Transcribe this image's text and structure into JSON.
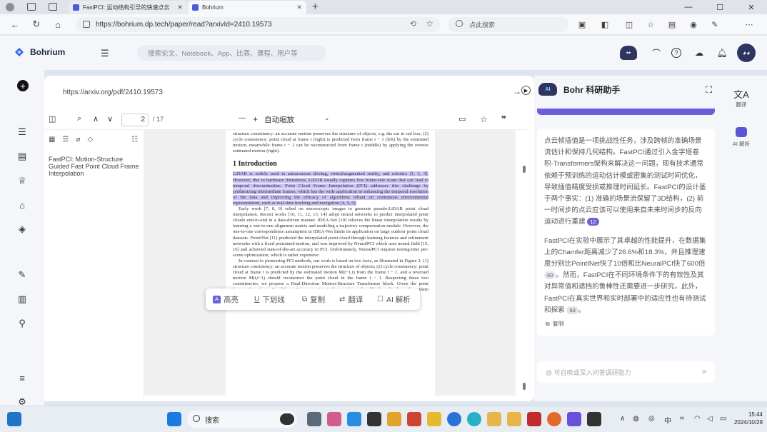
{
  "browser": {
    "tabs": [
      {
        "title": "FastPCI: 运动结构引导的快速点云"
      },
      {
        "title": "Bohrium"
      }
    ],
    "new_tab": "+",
    "url": "https://bohrium.dp.tech/paper/read?arxivId=2410.19573",
    "search_placeholder": "点此搜索"
  },
  "app": {
    "brand": "Bohrium",
    "search_placeholder": "搜索论文、Notebook、App、比赛、课程、用户等"
  },
  "pdf": {
    "source_url": "https://arxiv.org/pdf/2410.19573",
    "page_current": "2",
    "page_total": "/ 17",
    "zoom": "自动缩放",
    "zoom_minus": "—",
    "zoom_plus": "+",
    "outline_title": "FastPCI: Motion-Structure Guided Fast Point Cloud Frame Interpolation",
    "page_text": {
      "top_para": "structure consistency: an accurate motion preserves the structure of objects, e.g. the car in red box; (2) cycle consistency: point cloud at frame t (right) is predicted from frame t − 1 (left) by the estimated motion, meanwhile frame t − 1 can be reconstructed from frame t (middle) by applying the reverse estimated motion (right).",
      "section_title": "1   Introduction",
      "highlight_para": "LiDAR is widely used in autonomous driving, virtual/augmented reality, and robotics [1, 2, 3]. However, due to hardware limitations, LiDAR usually captures low frame-rate scans that can lead to temporal discontinuities. Point Cloud Frame Interpolation (PCI) addresses this challenge by synthesizing intermediate frames, which has the wide application in enhancing the temporal resolution of the data and improving the efficacy of algorithms reliant on continuous environmental representation, such as real-time tracking and navigation [4, 5, 6].",
      "para2": "Early work [7, 8, 9] relied on stereoscopic images to generate pseudo-LiDAR point cloud interpolation. Recent works [10, 11, 12, 13, 14] adopt neural networks to predict interpolated point clouds end-to-end in a data-driven manner. IDEA-Net [10] relieves the linear interpolation results by learning a one-to-one alignment matrix and modeling a trajectory compensation module. However, the one-to-one correspondence assumption in IDEA-Net limits its application on large outdoor point cloud datasets. PointINet [11] predicted the interpolated point cloud through learning features and refinement networks with a fixed pretrained motion, and was improved by NeuralPCI which uses neural field [15, 16] and achieved state-of-the-art accuracy in PCI. Unfortunately, NeuralPCI requires testing-time per-scene optimization, which is rather expensive.",
      "para3": "In contrast to pioneering PCI methods, our work is based on two facts, as illustrated in Figure 2: (1) structure consistency: an accurate motion preserves the structure of objects; (2) cycle consistency: point cloud at frame t is predicted by the estimated motion M(t−1,t) from the frame t − 1, and a reversed motion M(t,t−1) should reconstruct the point cloud in the frame t − 1. Respecting these two consistencies, we propose a Dual-Direction Motion-Structure Transformer block. Given the point features from frame 0 and frame 1, we concatenate them in forward and backward order and use them for a bidirectional input in the block to ensure"
    },
    "selection_menu": [
      {
        "label": "高亮",
        "icon": "highlight-icon"
      },
      {
        "label": "下划线",
        "icon": "underline-icon"
      },
      {
        "label": "复制",
        "icon": "copy-icon"
      },
      {
        "label": "翻译",
        "icon": "translate-icon"
      },
      {
        "label": "AI 解析",
        "icon": "ai-icon"
      }
    ]
  },
  "assistant": {
    "title": "Bohr 科研助手",
    "para1": "点云帧插值是一项挑战性任务，涉及跨帧的准确场景流估计和保持几何结构。FastPCI通过引入金字塔卷积-Transformers架构来解决这一问题，现有技术通常依赖于预训练的运动估计模或密集的测试时间优化，导致插值精度受损或推理时间延长。FastPCI的设计基于两个事实：(1) 准确的场景流保留了3D结构，(2) 前一时间步的点云应该可以使用来自未来时间步的反向运动进行重建",
    "badge1": "12",
    "para2a": "FastPCI在实验中展示了其卓越的性能提升，在数据集上的Chamfer距离减少了26.6%和18.3%，并且推理速度分别比PointINet快了10倍和比NeuralPCI快了600倍",
    "badge2": "60",
    "para2b": "。然而，FastPCI在不同环境条件下的有效性及其对异常值和遮挡的鲁棒性还需要进一步研究。此外，FastPCI在真实世界和实时部署中的适应性也有待测试和探索",
    "badge3": "83",
    "para2c": "。",
    "copy_label": "复制",
    "input_placeholder": "@ 可召唤或深入问答调研能力",
    "side_translate": "翻译",
    "side_ai": "AI 解析"
  },
  "taskbar": {
    "search": "搜索",
    "ime": "中",
    "time": "15:44",
    "date": "2024/10/29"
  }
}
